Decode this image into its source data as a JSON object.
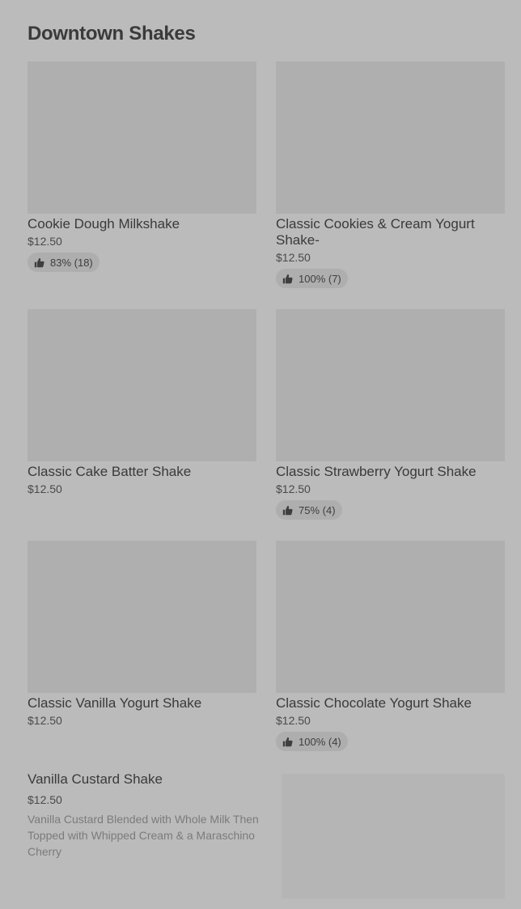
{
  "section": {
    "title": "Downtown Shakes"
  },
  "items": [
    {
      "name": "Cookie Dough Milkshake",
      "price": "$12.50",
      "rating": "83% (18)"
    },
    {
      "name": "Classic Cookies & Cream Yogurt Shake-",
      "price": "$12.50",
      "rating": "100% (7)"
    },
    {
      "name": "Classic Cake Batter Shake",
      "price": "$12.50",
      "rating": ""
    },
    {
      "name": "Classic Strawberry Yogurt Shake",
      "price": "$12.50",
      "rating": "75% (4)"
    },
    {
      "name": "Classic Vanilla Yogurt Shake",
      "price": "$12.50",
      "rating": ""
    },
    {
      "name": "Classic Chocolate Yogurt Shake",
      "price": "$12.50",
      "rating": "100% (4)"
    }
  ],
  "featured": {
    "name": "Vanilla Custard Shake",
    "price": "$12.50",
    "description": "Vanilla Custard Blended with Whole Milk Then Topped with Whipped Cream & a Maraschino Cherry"
  },
  "icons": {
    "rating": "thumbs-up-icon"
  },
  "colors": {
    "background": "#bbbbbb",
    "image_placeholder": "#afafaf",
    "badge": "#aeaeae"
  }
}
